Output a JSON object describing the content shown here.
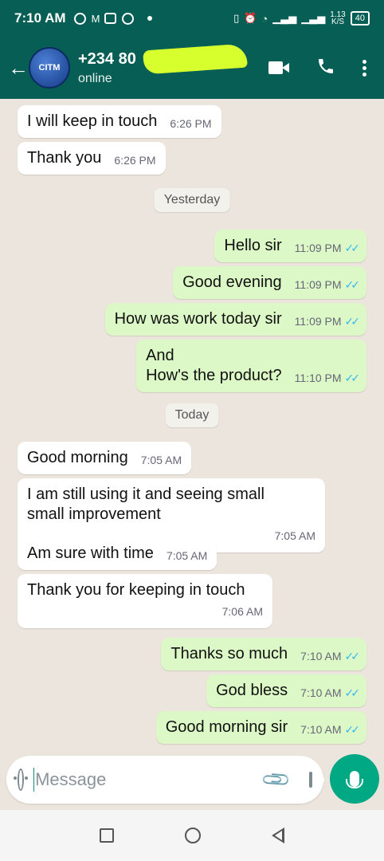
{
  "status_bar": {
    "time": "7:10 AM",
    "speed_top": "1.13",
    "speed_bottom": "K/S",
    "battery": "40"
  },
  "header": {
    "contact_name": "+234 80",
    "contact_status": "online",
    "avatar_text": "CITM"
  },
  "messages": [
    {
      "dir": "in",
      "text": "I will keep in touch",
      "time": "6:26 PM"
    },
    {
      "dir": "in",
      "text": "Thank you",
      "time": "6:26 PM"
    },
    {
      "date": "Yesterday"
    },
    {
      "dir": "out",
      "text": "Hello sir",
      "time": "11:09 PM"
    },
    {
      "dir": "out",
      "text": "Good evening",
      "time": "11:09 PM"
    },
    {
      "dir": "out",
      "text": "How was work today sir",
      "time": "11:09 PM"
    },
    {
      "dir": "out",
      "text": "And\nHow's the product?",
      "time": "11:10 PM"
    },
    {
      "date": "Today"
    },
    {
      "dir": "in",
      "text": "Good morning",
      "time": "7:05 AM"
    },
    {
      "dir": "in",
      "text": "I am still using it and seeing small\nsmall improvement",
      "time": "7:05 AM"
    },
    {
      "dir": "in",
      "text": "Am sure with time",
      "time": "7:05 AM"
    },
    {
      "dir": "in",
      "text": "Thank you for keeping in touch",
      "time": "7:06 AM"
    },
    {
      "dir": "out",
      "text": "Thanks so much",
      "time": "7:10 AM"
    },
    {
      "dir": "out",
      "text": "God bless",
      "time": "7:10 AM"
    },
    {
      "dir": "out",
      "text": "Good morning sir",
      "time": "7:10 AM"
    }
  ],
  "composer": {
    "placeholder": "Message"
  },
  "colors": {
    "header": "#075e54",
    "outgoing_bubble": "#dcf8c6",
    "incoming_bubble": "#ffffff",
    "chat_background": "#ece5dd",
    "read_ticks": "#34b7f1",
    "mic_button": "#00a884"
  }
}
